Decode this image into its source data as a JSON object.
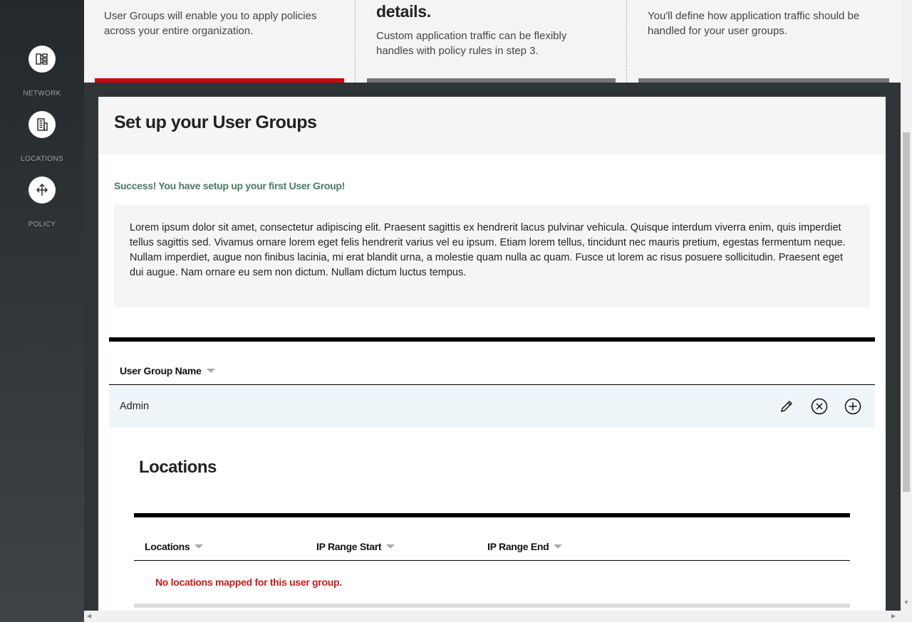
{
  "sidebar": {
    "items": [
      {
        "label": "NETWORK",
        "icon": "network-icon"
      },
      {
        "label": "LOCATIONS",
        "icon": "building-icon"
      },
      {
        "label": "POLICY",
        "icon": "move-arrows-icon"
      }
    ]
  },
  "steps": [
    {
      "title": "",
      "description": "User Groups will enable you to apply policies across your entire organization.",
      "bar_color": "#cd040b"
    },
    {
      "title": "details.",
      "description": "Custom application traffic can be flexibly handles with policy rules in step 3.",
      "bar_color": "#747676"
    },
    {
      "title": "",
      "description": "You'll define how application traffic should be handled for your user groups.",
      "bar_color": "#747676"
    }
  ],
  "modal": {
    "title": "Set up your User Groups",
    "success_message": "Success! You have setup up your first User Group!",
    "body_text": "Lorem ipsum dolor sit amet, consectetur adipiscing elit. Praesent sagittis ex hendrerit lacus pulvinar vehicula. Quisque interdum viverra enim, quis imperdiet tellus sagittis sed. Vivamus ornare lorem eget felis hendrerit varius vel eu ipsum. Etiam lorem tellus, tincidunt nec mauris pretium, egestas fermentum neque. Nullam imperdiet, augue non finibus lacinia, mi erat blandit urna, a molestie quam nulla ac quam. Fusce ut lorem ac risus posuere sollicitudin. Praesent eget dui augue. Nam ornare eu sem non dictum. Nullam dictum luctus tempus.",
    "user_groups_table": {
      "column": "User Group Name",
      "rows": [
        {
          "name": "Admin"
        }
      ],
      "actions": [
        "pencil-icon",
        "close-circle-icon",
        "plus-circle-icon"
      ]
    },
    "locations": {
      "title": "Locations",
      "columns": [
        "Locations",
        "IP Range Start",
        "IP Range End"
      ],
      "empty_message": "No locations mapped for this user group."
    }
  },
  "colors": {
    "accent_red": "#cd040b",
    "success_green": "#4a7a5e",
    "error_red": "#cc1a1a",
    "row_highlight": "#eef5f8"
  }
}
